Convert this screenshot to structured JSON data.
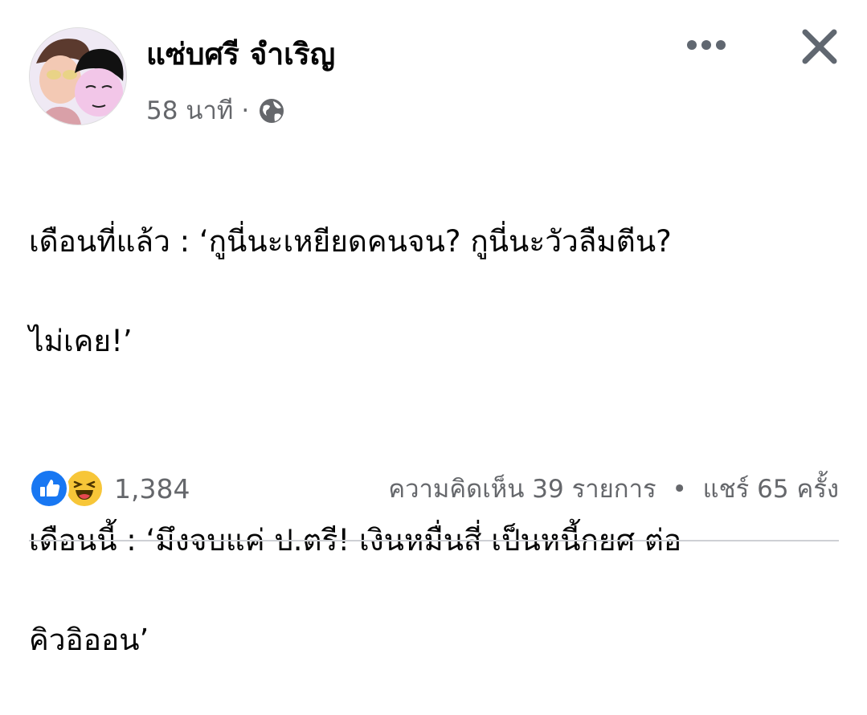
{
  "post_header": {
    "author_name": "แซ่บศรี จำเริญ",
    "time": "58 นาที",
    "separator": "·",
    "privacy_icon": "globe-icon",
    "more_icon": "more-options-icon",
    "close_icon": "close-icon"
  },
  "post_body": {
    "line1": "เดือนที่แล้ว :  ‘กูนี่นะเหยียดคนจน? กูนี่นะวัวลืมตีน?",
    "line2": "ไม่เคย!’",
    "line3": "เดือนนี้ : ‘มึงจบแค่ ป.ตรี! เงินหมื่นสี่ เป็นหนี้กยศ ต่อ",
    "line4": "คิวอิออน’"
  },
  "reactions": {
    "icons": [
      "like-icon",
      "haha-icon"
    ],
    "count": "1,384"
  },
  "engagement": {
    "comments": "ความคิดเห็น 39 รายการ",
    "separator": "•",
    "shares": "แชร์ 65 ครั้ง"
  },
  "colors": {
    "like_blue": "#1877f2",
    "haha_yellow": "#f7c638",
    "secondary_text": "#65676b",
    "icon_gray": "#606770"
  }
}
